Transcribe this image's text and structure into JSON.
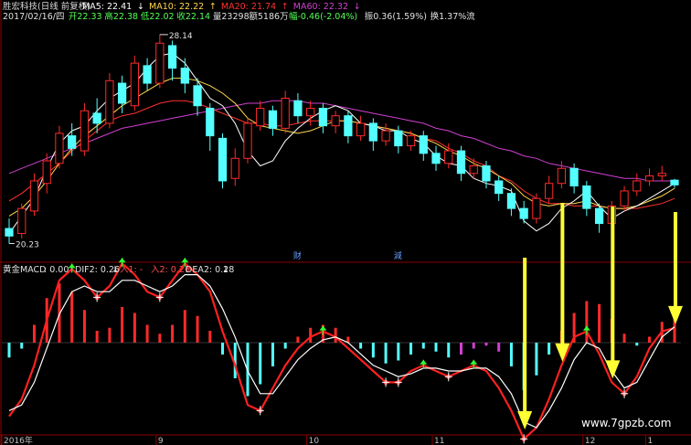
{
  "chart_data": [
    {
      "type": "candlestick",
      "panel": "price",
      "stock_title": "胜宏科技(日线 前复权)",
      "ma_legend": [
        {
          "label": "MA5: 22.41",
          "color": "#ffffff"
        },
        {
          "label": "MA10: 22.22",
          "color": "#ffd84a"
        },
        {
          "label": "MA20: 21.74",
          "color": "#ff3030"
        },
        {
          "label": "MA60: 22.32",
          "color": "#d040d0"
        }
      ],
      "ma_up_arrow": "↑",
      "ma_down_arrow": "↓",
      "info_line": {
        "date": "2017/02/16/四",
        "open": "开22.33",
        "high": "高22.38",
        "low": "低22.02",
        "close": "收22.14",
        "volume": "量23298",
        "amount": "额5186万",
        "change": "幅-0.46(-2.04%)",
        "amplitude": "振0.36(1.59%)",
        "turnover": "换1.37%",
        "flow": "流"
      },
      "high_annotation": "28.14",
      "low_annotation": "20.23",
      "event_markers": [
        "财",
        "減"
      ],
      "ma5": [
        20.2,
        20.9,
        21.6,
        22.8,
        23.8,
        24.3,
        24.5,
        25.1,
        25.6,
        25.9,
        26.2,
        26.8,
        27.3,
        27.4,
        27.0,
        26.3,
        25.6,
        25.3,
        24.6,
        23.5,
        22.9,
        23.1,
        23.9,
        24.4,
        24.8,
        25.1,
        25.3,
        25.1,
        24.6,
        24.5,
        24.3,
        24.3,
        24.0,
        23.8,
        23.3,
        23.0,
        22.9,
        22.4,
        22.2,
        22.1,
        21.9,
        20.7,
        20.3,
        20.6,
        21.2,
        21.5,
        21.9,
        21.3,
        20.8,
        21.1,
        21.3,
        21.6,
        21.9,
        22.2
      ],
      "ma10": [
        20.9,
        21.2,
        21.7,
        22.3,
        23.0,
        23.6,
        24.1,
        24.5,
        24.9,
        25.3,
        25.6,
        25.9,
        26.2,
        26.4,
        26.4,
        26.3,
        26.1,
        25.8,
        25.4,
        24.8,
        24.5,
        24.4,
        24.3,
        24.2,
        24.3,
        24.5,
        24.7,
        24.7,
        24.6,
        24.5,
        24.4,
        24.3,
        24.2,
        24.0,
        23.8,
        23.5,
        23.3,
        23.0,
        22.8,
        22.5,
        22.2,
        21.7,
        21.4,
        21.3,
        21.4,
        21.4,
        21.5,
        21.3,
        21.2,
        21.2,
        21.3,
        21.5,
        21.7,
        22.0
      ],
      "ma20": [
        21.5,
        21.8,
        22.2,
        22.6,
        23.0,
        23.5,
        23.9,
        24.3,
        24.7,
        24.9,
        25.0,
        25.2,
        25.4,
        25.5,
        25.5,
        25.4,
        25.2,
        25.0,
        24.8,
        24.6,
        24.6,
        24.5,
        24.5,
        24.6,
        24.7,
        24.7,
        24.7,
        24.7,
        24.6,
        24.5,
        24.4,
        24.3,
        24.2,
        24.0,
        23.9,
        23.6,
        23.4,
        23.1,
        22.9,
        22.5,
        22.3,
        21.9,
        21.6,
        21.4,
        21.4,
        21.3,
        21.3,
        21.3,
        21.2,
        21.2,
        21.2,
        21.3,
        21.4,
        21.6
      ],
      "ma60": [
        22.6,
        22.8,
        23.0,
        23.2,
        23.4,
        23.6,
        23.8,
        24.0,
        24.2,
        24.4,
        24.5,
        24.6,
        24.7,
        24.8,
        24.9,
        25.0,
        25.1,
        25.2,
        25.3,
        25.4,
        25.4,
        25.5,
        25.5,
        25.5,
        25.4,
        25.4,
        25.3,
        25.2,
        25.1,
        25.0,
        24.9,
        24.8,
        24.7,
        24.6,
        24.4,
        24.3,
        24.1,
        24.0,
        23.8,
        23.6,
        23.5,
        23.3,
        23.2,
        23.0,
        22.9,
        22.8,
        22.7,
        22.6,
        22.5,
        22.4,
        22.4,
        22.3,
        22.3,
        22.3
      ],
      "candles": [
        {
          "o": 20.4,
          "c": 20.1,
          "h": 20.8,
          "l": 19.8
        },
        {
          "o": 20.2,
          "c": 21.2,
          "h": 21.4,
          "l": 20.0
        },
        {
          "o": 21.1,
          "c": 22.3,
          "h": 22.6,
          "l": 20.9
        },
        {
          "o": 22.2,
          "c": 23.1,
          "h": 23.4,
          "l": 21.8
        },
        {
          "o": 23.0,
          "c": 24.2,
          "h": 24.5,
          "l": 22.8
        },
        {
          "o": 24.1,
          "c": 23.6,
          "h": 24.6,
          "l": 23.3
        },
        {
          "o": 23.5,
          "c": 25.1,
          "h": 25.4,
          "l": 23.3
        },
        {
          "o": 25.0,
          "c": 24.6,
          "h": 25.6,
          "l": 24.2
        },
        {
          "o": 24.6,
          "c": 26.3,
          "h": 26.6,
          "l": 24.4
        },
        {
          "o": 26.2,
          "c": 25.4,
          "h": 26.5,
          "l": 25.0
        },
        {
          "o": 25.3,
          "c": 27.0,
          "h": 27.3,
          "l": 25.1
        },
        {
          "o": 26.9,
          "c": 26.2,
          "h": 27.2,
          "l": 25.9
        },
        {
          "o": 26.2,
          "c": 27.8,
          "h": 28.14,
          "l": 26.0
        },
        {
          "o": 27.7,
          "c": 26.8,
          "h": 27.9,
          "l": 26.3
        },
        {
          "o": 26.8,
          "c": 26.2,
          "h": 27.2,
          "l": 25.8
        },
        {
          "o": 26.1,
          "c": 25.3,
          "h": 26.4,
          "l": 24.9
        },
        {
          "o": 25.2,
          "c": 24.1,
          "h": 25.4,
          "l": 23.5
        },
        {
          "o": 24.0,
          "c": 22.3,
          "h": 24.2,
          "l": 22.0
        },
        {
          "o": 22.4,
          "c": 23.2,
          "h": 23.6,
          "l": 22.1
        },
        {
          "o": 23.2,
          "c": 24.6,
          "h": 24.8,
          "l": 23.0
        },
        {
          "o": 24.5,
          "c": 25.2,
          "h": 25.5,
          "l": 24.3
        },
        {
          "o": 25.1,
          "c": 24.4,
          "h": 25.3,
          "l": 24.1
        },
        {
          "o": 24.4,
          "c": 25.6,
          "h": 25.9,
          "l": 24.2
        },
        {
          "o": 25.5,
          "c": 24.9,
          "h": 25.8,
          "l": 24.6
        },
        {
          "o": 24.9,
          "c": 25.2,
          "h": 25.5,
          "l": 24.5
        },
        {
          "o": 25.2,
          "c": 24.5,
          "h": 25.4,
          "l": 24.2
        },
        {
          "o": 24.5,
          "c": 24.9,
          "h": 25.1,
          "l": 24.2
        },
        {
          "o": 24.9,
          "c": 24.1,
          "h": 25.1,
          "l": 23.8
        },
        {
          "o": 24.1,
          "c": 24.6,
          "h": 24.9,
          "l": 23.9
        },
        {
          "o": 24.6,
          "c": 23.9,
          "h": 24.8,
          "l": 23.5
        },
        {
          "o": 23.9,
          "c": 24.3,
          "h": 24.6,
          "l": 23.7
        },
        {
          "o": 24.3,
          "c": 23.7,
          "h": 24.5,
          "l": 23.4
        },
        {
          "o": 23.7,
          "c": 24.1,
          "h": 24.3,
          "l": 23.5
        },
        {
          "o": 24.1,
          "c": 23.4,
          "h": 24.3,
          "l": 23.1
        },
        {
          "o": 23.4,
          "c": 23.0,
          "h": 23.7,
          "l": 22.7
        },
        {
          "o": 23.0,
          "c": 23.5,
          "h": 23.8,
          "l": 22.8
        },
        {
          "o": 23.5,
          "c": 22.6,
          "h": 23.7,
          "l": 22.3
        },
        {
          "o": 22.6,
          "c": 22.9,
          "h": 23.2,
          "l": 22.4
        },
        {
          "o": 22.9,
          "c": 22.3,
          "h": 23.1,
          "l": 22.0
        },
        {
          "o": 22.3,
          "c": 21.8,
          "h": 22.5,
          "l": 21.5
        },
        {
          "o": 21.8,
          "c": 21.2,
          "h": 22.0,
          "l": 20.9
        },
        {
          "o": 21.2,
          "c": 20.8,
          "h": 21.5,
          "l": 20.6
        },
        {
          "o": 20.8,
          "c": 21.6,
          "h": 21.8,
          "l": 20.6
        },
        {
          "o": 21.6,
          "c": 22.2,
          "h": 22.5,
          "l": 21.4
        },
        {
          "o": 22.2,
          "c": 22.8,
          "h": 23.1,
          "l": 22.0
        },
        {
          "o": 22.8,
          "c": 22.1,
          "h": 23.0,
          "l": 21.8
        },
        {
          "o": 22.1,
          "c": 21.2,
          "h": 22.3,
          "l": 20.9
        },
        {
          "o": 21.2,
          "c": 20.6,
          "h": 21.4,
          "l": 20.23
        },
        {
          "o": 20.6,
          "c": 21.3,
          "h": 21.5,
          "l": 20.4
        },
        {
          "o": 21.3,
          "c": 21.9,
          "h": 22.1,
          "l": 21.1
        },
        {
          "o": 21.9,
          "c": 22.3,
          "h": 22.6,
          "l": 21.7
        },
        {
          "o": 22.3,
          "c": 22.5,
          "h": 22.8,
          "l": 22.1
        },
        {
          "o": 22.5,
          "c": 22.6,
          "h": 22.9,
          "l": 22.3
        },
        {
          "o": 22.33,
          "c": 22.14,
          "h": 22.38,
          "l": 22.02
        }
      ]
    },
    {
      "type": "macd",
      "panel": "indicator",
      "header": {
        "name": "黄金MACD",
        "value": ": 0.00",
        "dif2": "DIF2: 0.26",
        "entry1": "入1: -",
        "entry2": "入2: 0.26",
        "dea2": "DEA2: 0.28"
      },
      "histogram": [
        -0.25,
        -0.1,
        0.3,
        0.75,
        1.0,
        0.85,
        0.55,
        0.2,
        0.25,
        0.6,
        0.5,
        0.3,
        0.15,
        0.3,
        0.55,
        0.45,
        0.2,
        -0.2,
        -0.6,
        -0.9,
        -0.7,
        -0.4,
        -0.1,
        0.1,
        0.25,
        0.3,
        0.25,
        0.1,
        -0.1,
        -0.25,
        -0.35,
        -0.3,
        -0.2,
        -0.1,
        -0.15,
        -0.25,
        -0.2,
        -0.1,
        -0.05,
        -0.15,
        -0.4,
        -0.8,
        -0.55,
        -0.2,
        0.2,
        0.5,
        0.7,
        0.65,
        0.4,
        0.15,
        -0.05,
        0.1,
        0.35,
        0.45
      ],
      "dif": [
        -1.3,
        -1.0,
        -0.4,
        0.4,
        1.1,
        1.3,
        1.1,
        0.8,
        1.0,
        1.4,
        1.2,
        0.9,
        0.8,
        1.1,
        1.4,
        1.2,
        0.9,
        0.2,
        -0.4,
        -1.1,
        -1.2,
        -0.8,
        -0.4,
        -0.1,
        0.1,
        0.2,
        0.1,
        -0.1,
        -0.3,
        -0.5,
        -0.7,
        -0.7,
        -0.5,
        -0.4,
        -0.5,
        -0.6,
        -0.5,
        -0.4,
        -0.5,
        -0.8,
        -1.2,
        -1.7,
        -1.5,
        -1.0,
        -0.4,
        0.1,
        0.2,
        -0.2,
        -0.7,
        -0.9,
        -0.6,
        -0.1,
        0.2,
        0.26
      ],
      "dea": [
        -1.2,
        -1.1,
        -0.7,
        -0.1,
        0.5,
        0.9,
        1.0,
        0.9,
        0.9,
        1.1,
        1.1,
        1.0,
        0.9,
        1.0,
        1.2,
        1.2,
        1.0,
        0.6,
        0.1,
        -0.5,
        -0.9,
        -0.9,
        -0.6,
        -0.3,
        -0.1,
        0.05,
        0.1,
        0.0,
        -0.2,
        -0.4,
        -0.5,
        -0.6,
        -0.55,
        -0.45,
        -0.45,
        -0.5,
        -0.5,
        -0.45,
        -0.45,
        -0.6,
        -0.9,
        -1.4,
        -1.5,
        -1.2,
        -0.8,
        -0.3,
        0.0,
        -0.1,
        -0.5,
        -0.8,
        -0.7,
        -0.3,
        0.1,
        0.28
      ],
      "buy_signal_indices": [
        44,
        51,
        53
      ],
      "arrow_targets": [
        41,
        44,
        48,
        53
      ]
    }
  ],
  "time_axis": [
    "2016年",
    "9",
    "10",
    "11",
    "12",
    "1"
  ],
  "watermark": "www.7gpzb.com",
  "colors": {
    "up": "#ff2a2a",
    "down": "#54ffff",
    "ma5": "#ffffff",
    "ma10": "#ffd84a",
    "ma20": "#ff3030",
    "ma60": "#d040d0",
    "dif": "#ff2020",
    "dea": "#ffffff",
    "hist_pos": "#ff2a2a",
    "hist_neg": "#54ffff",
    "hist_neg_alt": "#d040d0",
    "arrow": "#ffff33",
    "grid": "#7a0000",
    "axis_text": "#c0c0c0"
  }
}
